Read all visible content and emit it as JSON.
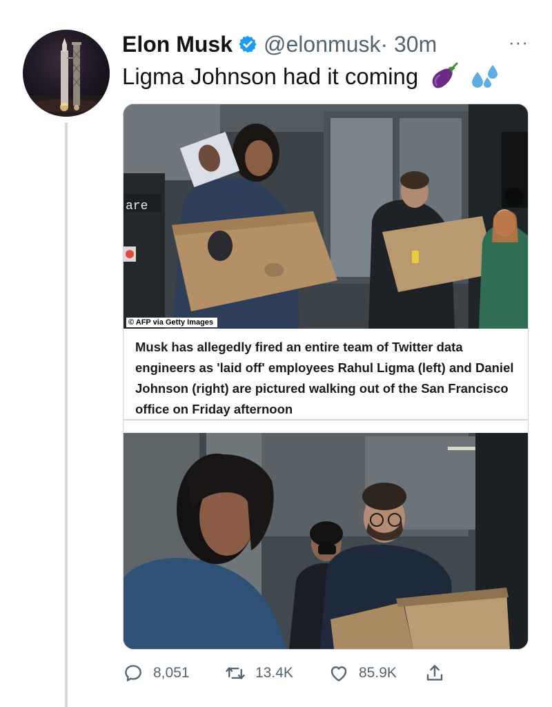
{
  "tweet": {
    "author_name": "Elon Musk",
    "author_handle": "@elonmusk",
    "time": "· 30m",
    "more_glyph": "···",
    "text": "Ligma Johnson had it coming",
    "emojis": [
      "eggplant-emoji",
      "sweat-droplets-emoji"
    ]
  },
  "media": {
    "photo_credit": "© AFP via Getty Images",
    "caption": "Musk has allegedly fired an entire team of Twitter data engineers as 'laid off' employees Rahul Ligma (left) and Daniel Johnson (right) are pictured walking out of the San Francisco office on Friday afternoon",
    "signage_text": "are"
  },
  "actions": {
    "replies": "8,051",
    "retweets": "13.4K",
    "likes": "85.9K"
  },
  "colors": {
    "verified": "#1d9bf0",
    "secondary_text": "#536471",
    "thread_line": "#cfd9de"
  }
}
